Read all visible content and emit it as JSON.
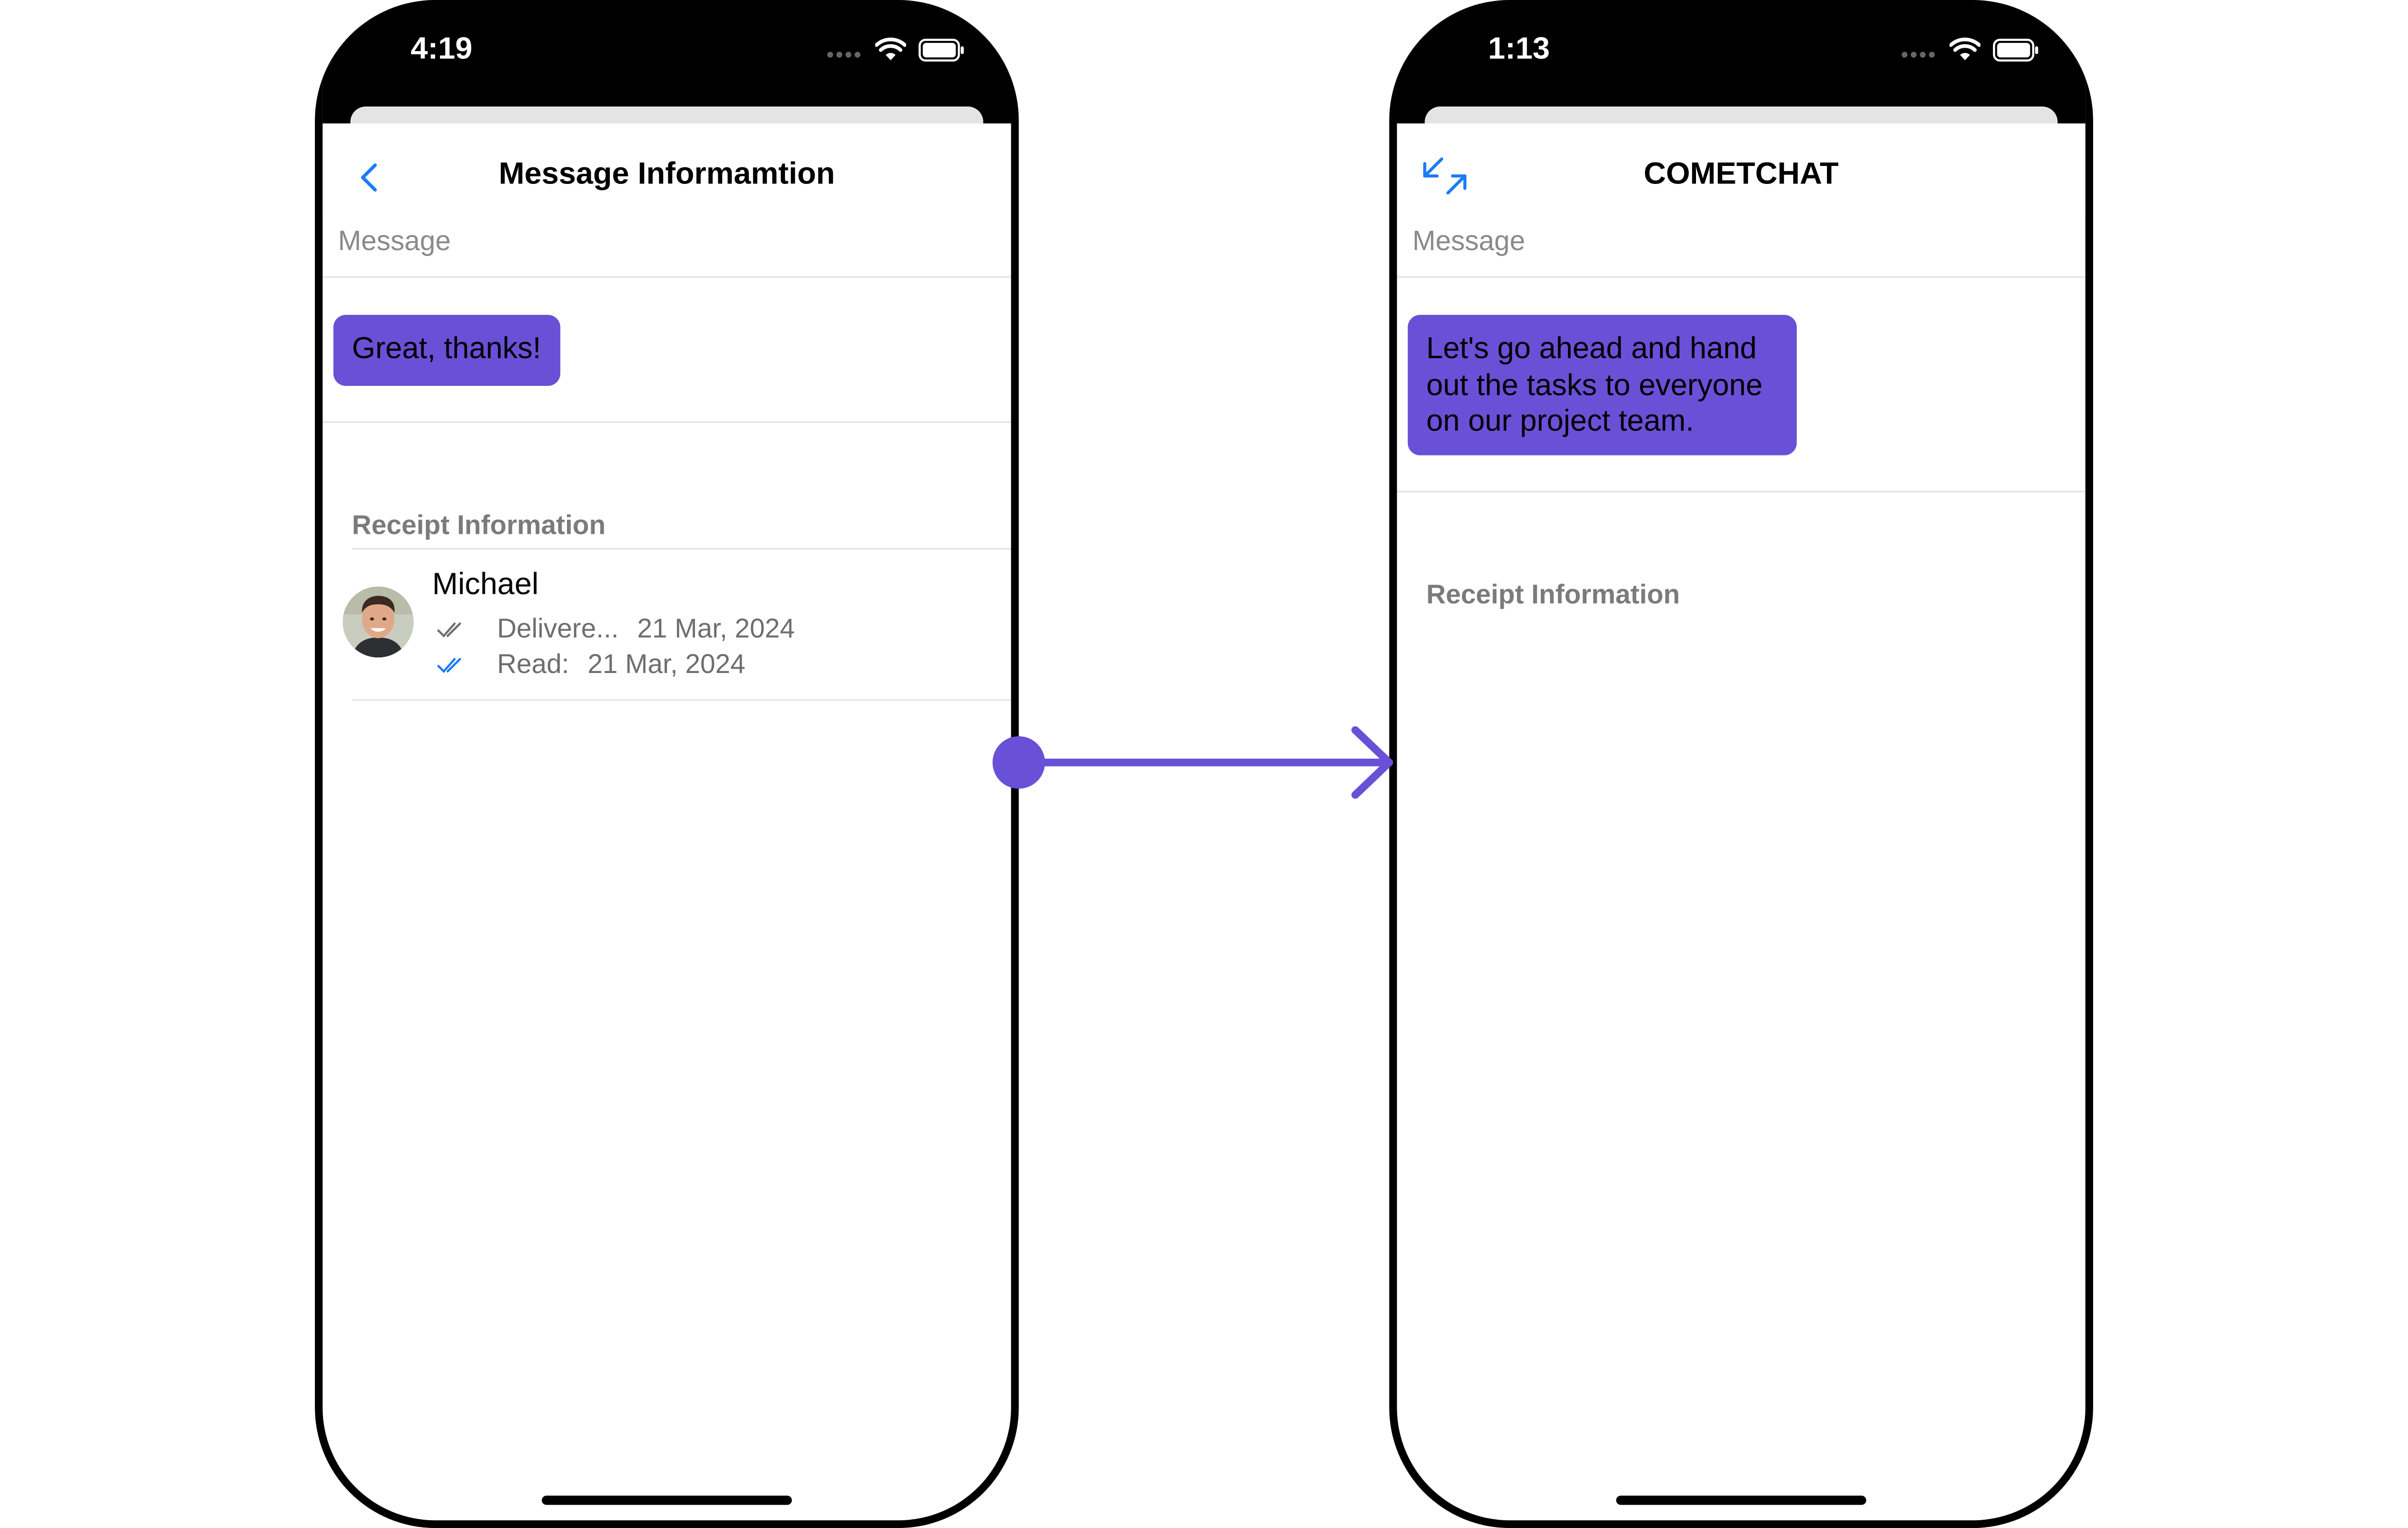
{
  "colors": {
    "accent": "#6851d6",
    "ios_blue": "#1a7cf5",
    "divider": "#e3e3e3",
    "secondary_text": "#8a8a8a"
  },
  "left_phone": {
    "status_time": "4:19",
    "status_icons": [
      "cellular-dots-icon",
      "wifi-icon",
      "battery-icon"
    ],
    "nav": {
      "back_icon": "chevron-left-icon",
      "title": "Message Informamtion"
    },
    "message_section_label": "Message",
    "message_bubble_text": "Great, thanks!",
    "receipt_heading": "Receipt Information",
    "receipt": {
      "avatar_icon": "user-avatar-photo",
      "name": "Michael",
      "delivered_label": "Delivere...",
      "delivered_date": "21 Mar, 2024",
      "read_label": "Read:",
      "read_date": "21 Mar, 2024"
    }
  },
  "right_phone": {
    "status_time": "1:13",
    "status_icons": [
      "cellular-dots-icon",
      "wifi-icon",
      "battery-icon"
    ],
    "nav": {
      "close_icon": "swap-arrows-icon",
      "title": "COMETCHAT"
    },
    "message_section_label": "Message",
    "message_bubble_lines": [
      "Let's go ahead and hand",
      "out the tasks to everyone",
      "on our project team."
    ],
    "receipt_heading": "Receipt Information"
  },
  "connector": {
    "icon": "arrow-right-icon"
  }
}
